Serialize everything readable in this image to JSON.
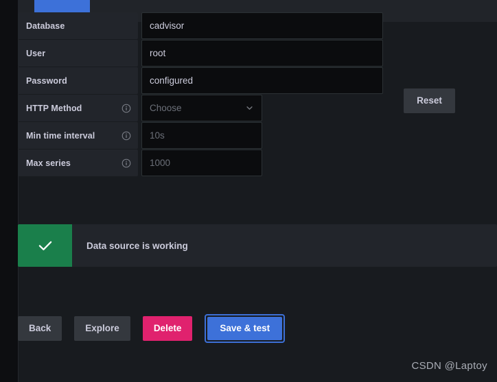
{
  "header": {
    "active_tab_label": ""
  },
  "form": {
    "rows": [
      {
        "label": "Database",
        "has_info": false,
        "value": "cadvisor",
        "placeholder": "",
        "is_placeholder": false,
        "control": "text",
        "width": "wide"
      },
      {
        "label": "User",
        "has_info": false,
        "value": "root",
        "placeholder": "",
        "is_placeholder": false,
        "control": "text",
        "width": "wide"
      },
      {
        "label": "Password",
        "has_info": false,
        "value": "configured",
        "placeholder": "",
        "is_placeholder": false,
        "control": "text",
        "width": "wide"
      },
      {
        "label": "HTTP Method",
        "has_info": true,
        "value": "Choose",
        "placeholder": "Choose",
        "is_placeholder": true,
        "control": "select",
        "width": "narrow"
      },
      {
        "label": "Min time interval",
        "has_info": true,
        "value": "10s",
        "placeholder": "10s",
        "is_placeholder": true,
        "control": "text",
        "width": "narrow"
      },
      {
        "label": "Max series",
        "has_info": true,
        "value": "1000",
        "placeholder": "1000",
        "is_placeholder": true,
        "control": "text",
        "width": "narrow"
      }
    ],
    "reset_label": "Reset"
  },
  "status": {
    "message": "Data source is working",
    "icon": "check-icon",
    "accent_color": "#1a7f4b"
  },
  "actions": {
    "back_label": "Back",
    "explore_label": "Explore",
    "delete_label": "Delete",
    "save_label": "Save & test",
    "delete_color": "#e0226e",
    "primary_color": "#3d71d9"
  },
  "watermark": {
    "text": "CSDN @Laptoy"
  }
}
